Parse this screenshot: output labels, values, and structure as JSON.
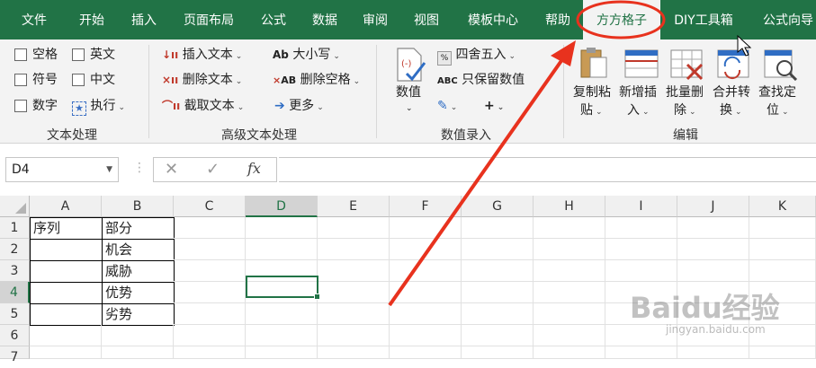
{
  "tabs": [
    "文件",
    "开始",
    "插入",
    "页面布局",
    "公式",
    "数据",
    "审阅",
    "视图",
    "模板中心",
    "帮助",
    "方方格子",
    "DIY工具箱",
    "公式向导"
  ],
  "active_tab": "方方格子",
  "ribbon": {
    "text_group": {
      "checkboxes": [
        "空格",
        "英文",
        "符号",
        "中文",
        "数字"
      ],
      "execute": "执行",
      "label": "文本处理"
    },
    "advanced_text_group": {
      "insert_text": "插入文本",
      "delete_text": "删除文本",
      "extract_text": "截取文本",
      "case": "大小写",
      "delete_spaces": "删除空格",
      "more": "更多",
      "label": "高级文本处理"
    },
    "number_group": {
      "value_btn": "数值",
      "round": "四舍五入",
      "keep_value": "只保留数值",
      "label": "数值录入"
    },
    "edit_group": {
      "copy_paste": [
        "复制粘",
        "贴"
      ],
      "add_insert": [
        "新增插",
        "入"
      ],
      "batch_delete": [
        "批量删",
        "除"
      ],
      "merge_convert": [
        "合并转",
        "换"
      ],
      "find_locate": [
        "查找定",
        "位"
      ],
      "label": "编辑"
    }
  },
  "formula_bar": {
    "name_box": "D4",
    "fx": "fx",
    "value": ""
  },
  "columns": [
    "A",
    "B",
    "C",
    "D",
    "E",
    "F",
    "G",
    "H",
    "I",
    "J",
    "K"
  ],
  "rows": [
    "1",
    "2",
    "3",
    "4",
    "5",
    "6",
    "7"
  ],
  "cells": {
    "A1": "序列",
    "B1": "部分",
    "B2": "机会",
    "B3": "威胁",
    "B4": "优势",
    "B5": "劣势"
  },
  "selected_cell": "D4",
  "watermark": {
    "main": "Baidu经验",
    "sub": "jingyan.baidu.com"
  },
  "annotation_color": "#e8321e",
  "accent": "#217346"
}
